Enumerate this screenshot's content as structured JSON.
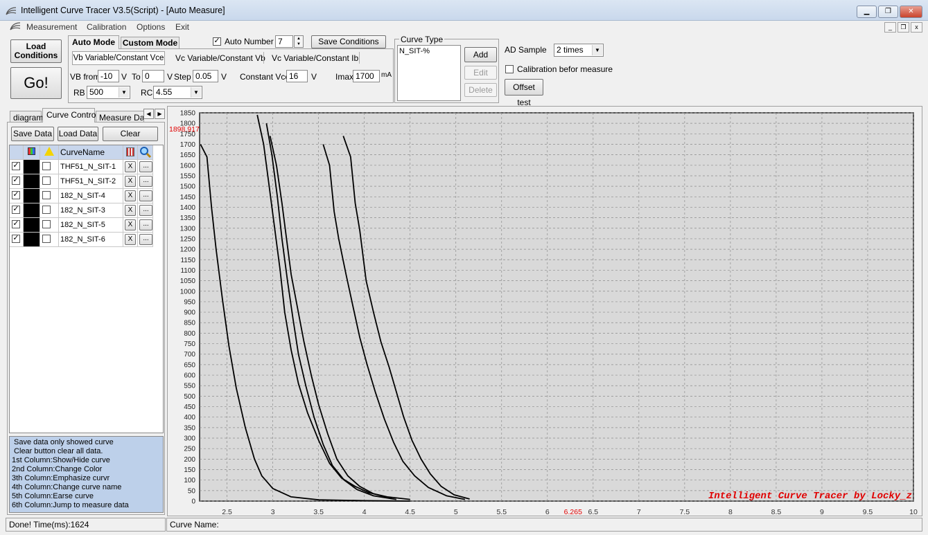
{
  "window": {
    "title": "Intelligent Curve Tracer V3.5(Script) - [Auto Measure]"
  },
  "menu": [
    "Measurement",
    "Calibration",
    "Options",
    "Exit"
  ],
  "buttons": {
    "load_conditions_1": "Load",
    "load_conditions_2": "Conditions",
    "go": "Go!",
    "save_conditions": "Save Conditions",
    "add": "Add",
    "edit": "Edit",
    "delete": "Delete",
    "offset_test": "Offset test"
  },
  "mode_tabs": {
    "auto": "Auto Mode",
    "custom": "Custom Mode"
  },
  "sub_tabs": [
    "Vb Variable/Constant Vce",
    "Vc Variable/Constant Vb",
    "Vc Variable/Constant Ib"
  ],
  "auto_number": {
    "label": "Auto Number",
    "value": "7",
    "checked": true
  },
  "params": {
    "vb_from_label": "VB from",
    "vb_from": "-10",
    "v1": "V",
    "to_label": "To",
    "to": "0",
    "v2": "V",
    "step_label": "Step",
    "step": "0.05",
    "v3": "V",
    "cvce_label": "Constant Vce",
    "cvce": "16",
    "v4": "V",
    "imax_label": "Imax",
    "imax": "1700",
    "ma": "mA",
    "rb_label": "RB",
    "rb": "500",
    "rc_label": "RC",
    "rc": "4.55"
  },
  "curve_type": {
    "legend": "Curve Type",
    "items": [
      "N_SIT-%"
    ]
  },
  "ad_sample": {
    "label": "AD Sample",
    "value": "2 times"
  },
  "calibration": {
    "label": "Calibration befor measure",
    "checked": false
  },
  "left_tabs": [
    "diagram",
    "Curve Control",
    "Measure Data"
  ],
  "left_buttons": {
    "save": "Save Data",
    "load": "Load Data",
    "clear": "Clear"
  },
  "table": {
    "header": "CurveName",
    "rows": [
      {
        "name": "THF51_N_SIT-1",
        "show": true,
        "color": "#000000",
        "emph": false
      },
      {
        "name": "THF51_N_SIT-2",
        "show": true,
        "color": "#000000",
        "emph": false
      },
      {
        "name": "182_N_SIT-4",
        "show": true,
        "color": "#000000",
        "emph": false
      },
      {
        "name": "182_N_SIT-3",
        "show": true,
        "color": "#000000",
        "emph": false
      },
      {
        "name": "182_N_SIT-5",
        "show": true,
        "color": "#000000",
        "emph": false
      },
      {
        "name": "182_N_SIT-6",
        "show": true,
        "color": "#000000",
        "emph": false
      }
    ],
    "erase_label": "X",
    "jump_label": "..."
  },
  "help_text": [
    " Save data only showed curve",
    " Clear button clear all data.",
    "1st Column:Show/Hide curve",
    "2nd Column:Change Color",
    "3th Column:Emphasize curvr",
    "4th Column:Change curve name",
    "5th Column:Earse curve",
    "6th Column:Jump to measure data"
  ],
  "status": {
    "left": "Done!  Time(ms):1624",
    "right": "Curve Name:"
  },
  "chart_data": {
    "type": "line",
    "xlim": [
      2.2,
      10
    ],
    "ylim": [
      0,
      1850
    ],
    "x_ticks": [
      2.5,
      3,
      3.5,
      4,
      4.5,
      5,
      5.5,
      6,
      6.5,
      7,
      7.5,
      8,
      8.5,
      9,
      9.5,
      10
    ],
    "y_ticks": [
      0,
      50,
      100,
      150,
      200,
      250,
      300,
      350,
      400,
      450,
      500,
      550,
      600,
      650,
      700,
      750,
      800,
      850,
      900,
      950,
      1000,
      1050,
      1100,
      1150,
      1200,
      1250,
      1300,
      1350,
      1400,
      1450,
      1500,
      1550,
      1600,
      1650,
      1700,
      1750,
      1800,
      1850
    ],
    "grid": true,
    "cursor": {
      "x_label": "6.265",
      "y_label": "1898.917",
      "x": 6.265
    },
    "watermark": "Intelligent Curve Tracer by Locky_z",
    "series": [
      {
        "x": [
          2.21,
          2.28,
          2.33,
          2.38,
          2.45,
          2.52,
          2.6,
          2.7,
          2.8,
          2.88,
          3.0,
          3.2,
          3.5,
          4.0,
          4.5
        ],
        "y": [
          1700,
          1640,
          1400,
          1200,
          960,
          740,
          540,
          350,
          200,
          120,
          60,
          20,
          6,
          2,
          0
        ]
      },
      {
        "x": [
          2.83,
          2.9,
          2.96,
          3.02,
          3.08,
          3.13,
          3.2,
          3.28,
          3.38,
          3.5,
          3.62,
          3.75,
          3.9,
          4.05,
          4.25,
          4.5
        ],
        "y": [
          1840,
          1700,
          1500,
          1300,
          1100,
          900,
          720,
          560,
          420,
          290,
          180,
          110,
          70,
          40,
          20,
          8
        ]
      },
      {
        "x": [
          2.93,
          2.99,
          3.05,
          3.1,
          3.16,
          3.22,
          3.28,
          3.36,
          3.45,
          3.55,
          3.65,
          3.78,
          3.92,
          4.1,
          4.35
        ],
        "y": [
          1800,
          1650,
          1450,
          1250,
          1050,
          870,
          700,
          550,
          400,
          270,
          170,
          100,
          55,
          25,
          8
        ]
      },
      {
        "x": [
          2.97,
          3.04,
          3.1,
          3.15,
          3.2,
          3.27,
          3.34,
          3.42,
          3.5,
          3.6,
          3.7,
          3.82,
          3.95,
          4.1,
          4.3
        ],
        "y": [
          1740,
          1600,
          1420,
          1250,
          1080,
          920,
          760,
          600,
          460,
          320,
          200,
          120,
          70,
          35,
          12
        ]
      },
      {
        "x": [
          3.55,
          3.62,
          3.67,
          3.72,
          3.8,
          3.88,
          3.95,
          4.03,
          4.12,
          4.22,
          4.32,
          4.42,
          4.55,
          4.7,
          4.9,
          5.1
        ],
        "y": [
          1700,
          1600,
          1380,
          1250,
          1080,
          920,
          780,
          650,
          520,
          390,
          280,
          190,
          120,
          65,
          25,
          8
        ]
      },
      {
        "x": [
          3.77,
          3.85,
          3.9,
          3.95,
          4.02,
          4.1,
          4.18,
          4.27,
          4.35,
          4.43,
          4.52,
          4.62,
          4.72,
          4.84,
          4.98,
          5.15
        ],
        "y": [
          1740,
          1640,
          1420,
          1290,
          1050,
          900,
          760,
          640,
          520,
          400,
          290,
          200,
          130,
          70,
          30,
          10
        ]
      }
    ]
  }
}
